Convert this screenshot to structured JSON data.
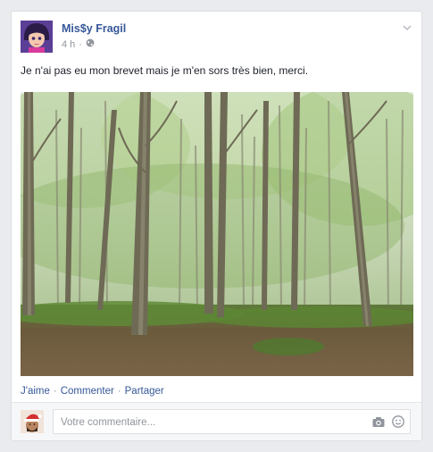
{
  "post": {
    "author": "Mis$y Fragil",
    "time": "4 h",
    "separator": "·",
    "privacy_icon": "globe-icon",
    "text": "Je n'ai pas eu mon brevet mais je m'en sors très bien, merci.",
    "photo_subject": "forest"
  },
  "actions": {
    "like": "J'aime",
    "comment": "Commenter",
    "share": "Partager",
    "dot": "·"
  },
  "comment_box": {
    "placeholder": "Votre commentaire...",
    "camera_icon": "camera-icon",
    "emoji_icon": "smiley-icon"
  },
  "colors": {
    "link": "#365899",
    "meta": "#90949c",
    "background": "#e9ebee"
  }
}
